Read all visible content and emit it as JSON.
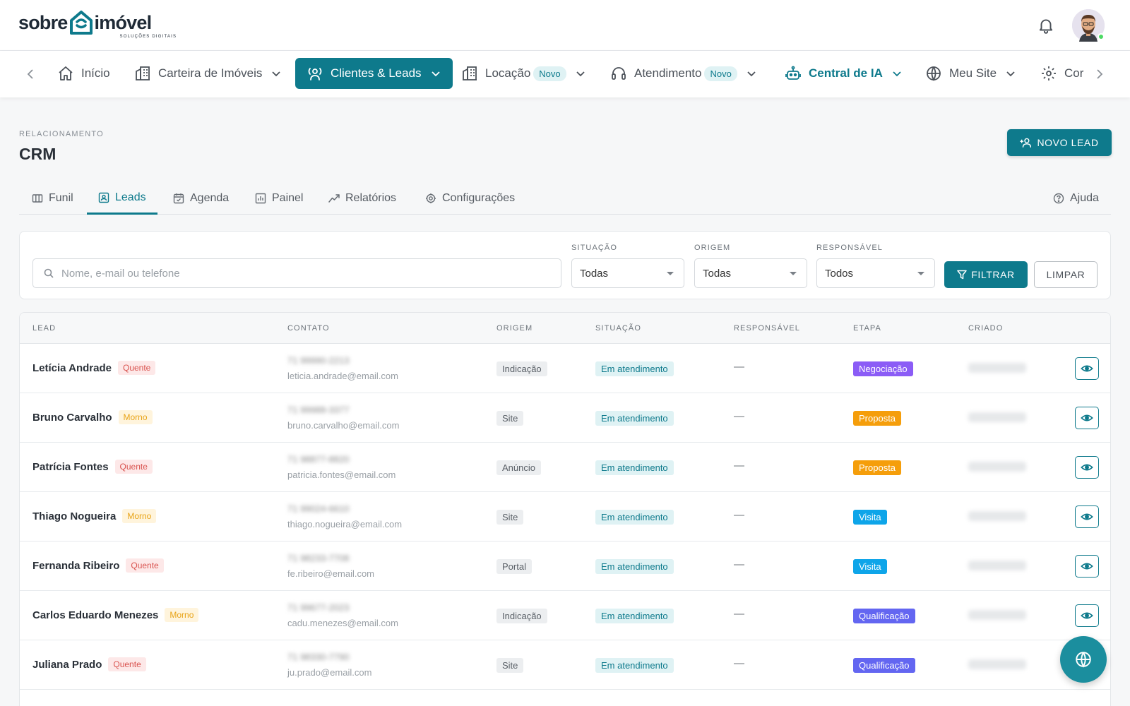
{
  "brand": {
    "word_left": "sobre",
    "word_right": "imóvel",
    "tagline": "SOLUÇÕES DIGITAIS",
    "color": "#0e7a8c"
  },
  "nav": {
    "items": [
      {
        "label": "Início",
        "icon": "home-icon"
      },
      {
        "label": "Carteira de Imóveis",
        "icon": "building-icon"
      },
      {
        "label": "Clientes & Leads",
        "icon": "user-broadcast-icon",
        "active": true
      },
      {
        "label": "Locação",
        "icon": "building-icon",
        "badge": "Novo"
      },
      {
        "label": "Atendimento",
        "icon": "headset-icon",
        "badge": "Novo"
      },
      {
        "label": "Central de IA",
        "icon": "robot-icon"
      },
      {
        "label": "Meu Site",
        "icon": "globe-icon"
      },
      {
        "label": "Cor",
        "icon": "gear-icon"
      }
    ]
  },
  "page": {
    "section": "RELACIONAMENTO",
    "title": "CRM",
    "new_lead_label": "NOVO LEAD"
  },
  "tabs": [
    {
      "label": "Funil",
      "icon": "columns-icon"
    },
    {
      "label": "Leads",
      "icon": "contact-icon",
      "active": true
    },
    {
      "label": "Agenda",
      "icon": "calendar-icon"
    },
    {
      "label": "Painel",
      "icon": "chart-icon"
    },
    {
      "label": "Relatórios",
      "icon": "trend-icon"
    },
    {
      "label": "Configurações",
      "icon": "gear-icon"
    }
  ],
  "help_label": "Ajuda",
  "filters": {
    "search_placeholder": "Nome, e-mail ou telefone",
    "situacao": {
      "label": "SITUAÇÃO",
      "value": "Todas"
    },
    "origem": {
      "label": "ORIGEM",
      "value": "Todas"
    },
    "responsavel": {
      "label": "RESPONSÁVEL",
      "value": "Todos"
    },
    "filter_label": "FILTRAR",
    "clear_label": "LIMPAR"
  },
  "table": {
    "headers": [
      "LEAD",
      "CONTATO",
      "ORIGEM",
      "SITUAÇÃO",
      "RESPONSÁVEL",
      "ETAPA",
      "CRIADO"
    ],
    "rows": [
      {
        "name": "Letícia Andrade",
        "temp": "Quente",
        "temp_kind": "quente",
        "phone": "71 99990-2213",
        "email": "leticia.andrade@email.com",
        "origem": "Indicação",
        "situacao": "Em atendimento",
        "responsavel": "—",
        "etapa": "Negociação",
        "etapa_color": "#8b5cf6"
      },
      {
        "name": "Bruno Carvalho",
        "temp": "Morno",
        "temp_kind": "morno",
        "phone": "71 99988-3377",
        "email": "bruno.carvalho@email.com",
        "origem": "Site",
        "situacao": "Em atendimento",
        "responsavel": "—",
        "etapa": "Proposta",
        "etapa_color": "#f59e0b"
      },
      {
        "name": "Patrícia Fontes",
        "temp": "Quente",
        "temp_kind": "quente",
        "phone": "71 98877-8820",
        "email": "patricia.fontes@email.com",
        "origem": "Anúncio",
        "situacao": "Em atendimento",
        "responsavel": "—",
        "etapa": "Proposta",
        "etapa_color": "#f59e0b"
      },
      {
        "name": "Thiago Nogueira",
        "temp": "Morno",
        "temp_kind": "morno",
        "phone": "71 99024-6610",
        "email": "thiago.nogueira@email.com",
        "origem": "Site",
        "situacao": "Em atendimento",
        "responsavel": "—",
        "etapa": "Visita",
        "etapa_color": "#0ea5e9"
      },
      {
        "name": "Fernanda Ribeiro",
        "temp": "Quente",
        "temp_kind": "quente",
        "phone": "71 98233-7708",
        "email": "fe.ribeiro@email.com",
        "origem": "Portal",
        "situacao": "Em atendimento",
        "responsavel": "—",
        "etapa": "Visita",
        "etapa_color": "#0ea5e9"
      },
      {
        "name": "Carlos Eduardo Menezes",
        "temp": "Morno",
        "temp_kind": "morno",
        "phone": "71 99677-2023",
        "email": "cadu.menezes@email.com",
        "origem": "Indicação",
        "situacao": "Em atendimento",
        "responsavel": "—",
        "etapa": "Qualificação",
        "etapa_color": "#6366f1"
      },
      {
        "name": "Juliana Prado",
        "temp": "Quente",
        "temp_kind": "quente",
        "phone": "71 98330-7790",
        "email": "ju.prado@email.com",
        "origem": "Site",
        "situacao": "Em atendimento",
        "responsavel": "—",
        "etapa": "Qualificação",
        "etapa_color": "#6366f1"
      }
    ]
  }
}
